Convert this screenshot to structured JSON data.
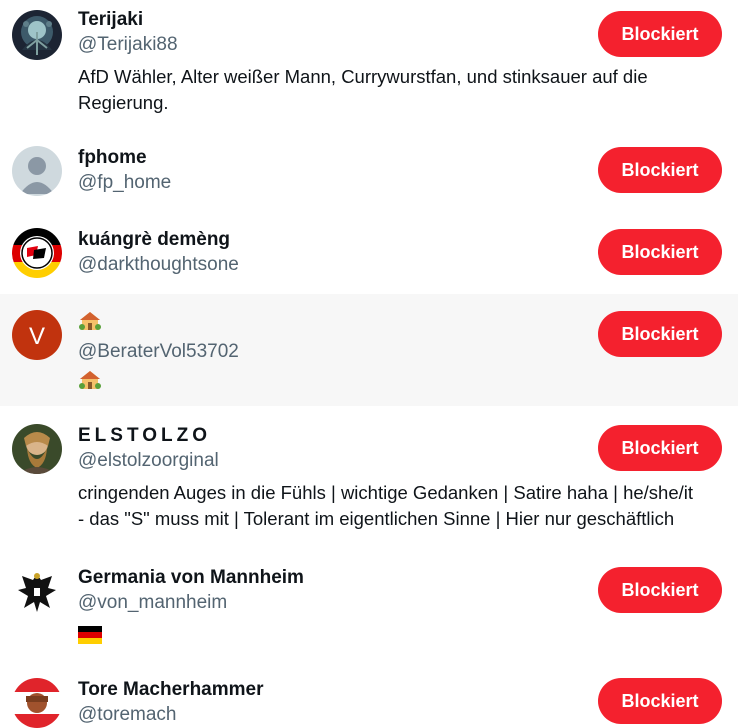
{
  "users": [
    {
      "name": "Terijaki",
      "handle": "@Terijaki88",
      "bio_lines": [
        "AfD Wähler, Alter weißer Mann, Currywurstfan, und stinksauer auf die",
        "Regierung."
      ],
      "button": "Blockiert",
      "avatar": "dark-tree-art"
    },
    {
      "name": "fphome",
      "handle": "@fp_home",
      "button": "Blockiert",
      "avatar": "default-silhouette"
    },
    {
      "name": "kuángrè demèng",
      "handle": "@darkthoughtsone",
      "button": "Blockiert",
      "avatar": "antifa-flag-german-colors"
    },
    {
      "name_icon": "house-with-garden-emoji",
      "handle": "@BeraterVol53702",
      "bio_icon": "house-with-garden-emoji",
      "button": "Blockiert",
      "avatar": "letter-v",
      "avatar_letter": "V",
      "avatar_color": "#c1330e"
    },
    {
      "name": "ELSTOLZO",
      "handle": "@elstolzoorginal",
      "bio_lines": [
        "cringenden Auges in die Fühls | wichtige Gedanken | Satire haha | he/she/it",
        "- das \"S\" muss mit | Tolerant im eigentlichen Sinne | Hier nur geschäftlich"
      ],
      "button": "Blockiert",
      "avatar": "bearded-man-photo"
    },
    {
      "name": "Germania von Mannheim",
      "handle": "@von_mannheim",
      "bio_icon": "german-flag-emoji",
      "button": "Blockiert",
      "avatar": "black-eagle-crest"
    },
    {
      "name": "Tore Macherhammer",
      "handle": "@toremach",
      "button": "Blockiert",
      "avatar": "red-white-photo"
    }
  ],
  "colors": {
    "block_button": "#f4212e",
    "handle_text": "#536471",
    "primary_text": "#0f1419",
    "hover_row": "#f7f7f7"
  }
}
